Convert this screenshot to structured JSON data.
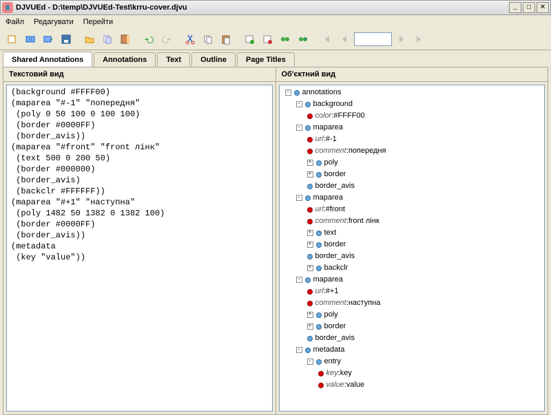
{
  "window": {
    "title": "DJVUEd - D:\\temp\\DJVUEd-Test\\krru-cover.djvu"
  },
  "menu": {
    "file": "Файл",
    "edit": "Редагувати",
    "go": "Перейти"
  },
  "tabs": {
    "shared": "Shared Annotations",
    "annotations": "Annotations",
    "text": "Text",
    "outline": "Outline",
    "page_titles": "Page Titles"
  },
  "panes": {
    "text_view": "Текстовий вид",
    "object_view": "Об'єктний вид"
  },
  "text_content": "(background #FFFF00)\n(maparea \"#-1\" \"попередня\"\n (poly 0 50 100 0 100 100)\n (border #0000FF)\n (border_avis))\n(maparea \"#front\" \"front лінк\"\n (text 500 0 200 50)\n (border #000000)\n (border_avis)\n (backclr #FFFFFF))\n(maparea \"#+1\" \"наступна\"\n (poly 1482 50 1382 0 1382 100)\n (border #0000FF)\n (border_avis))\n(metadata\n (key \"value\"))",
  "tree": {
    "root": "annotations",
    "bg": {
      "label": "background",
      "color_k": "color",
      "color_v": "#FFFF00"
    },
    "m1": {
      "label": "maparea",
      "url_k": "url",
      "url_v": "#-1",
      "comment_k": "comment",
      "comment_v": "попередня",
      "poly": "poly",
      "border": "border",
      "border_avis": "border_avis"
    },
    "m2": {
      "label": "maparea",
      "url_k": "url",
      "url_v": "#front",
      "comment_k": "comment",
      "comment_v": "front лінк",
      "text": "text",
      "border": "border",
      "border_avis": "border_avis",
      "backclr": "backclr"
    },
    "m3": {
      "label": "maparea",
      "url_k": "url",
      "url_v": "#+1",
      "comment_k": "comment",
      "comment_v": "наступна",
      "poly": "poly",
      "border": "border",
      "border_avis": "border_avis"
    },
    "meta": {
      "label": "metadata",
      "entry": "entry",
      "key_k": "key",
      "key_v": "key",
      "value_k": "value",
      "value_v": "value"
    }
  }
}
